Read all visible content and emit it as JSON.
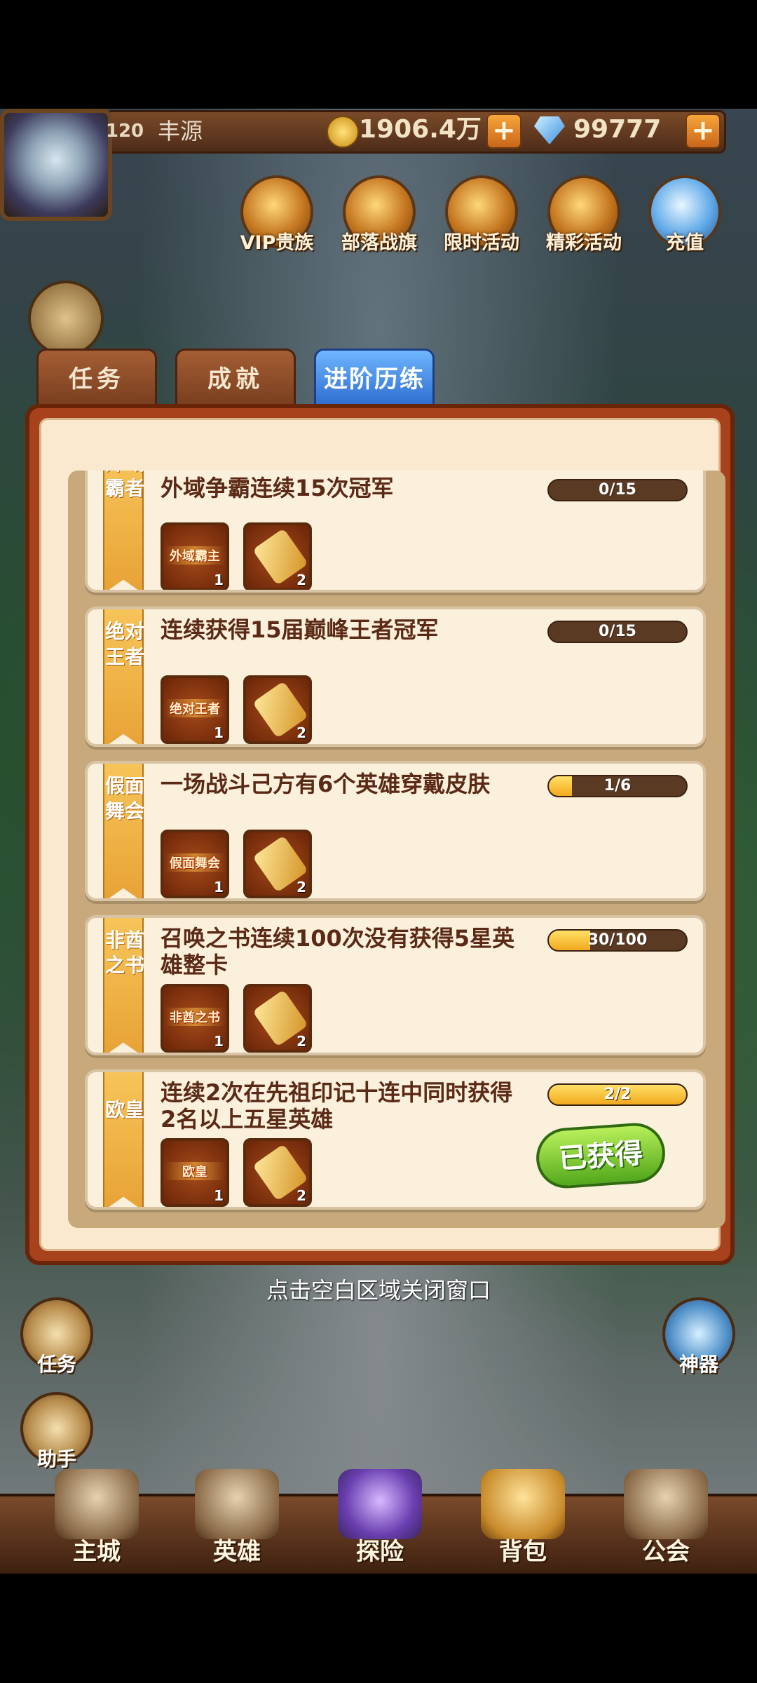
{
  "player": {
    "level": "120",
    "name": "丰源"
  },
  "currency": {
    "gold": "1906.4万",
    "gems": "99777",
    "plus": "+"
  },
  "top_icons": [
    {
      "label": "VIP贵族",
      "icon": "crown-icon"
    },
    {
      "label": "部落战旗",
      "icon": "war-flag-icon"
    },
    {
      "label": "限时活动",
      "icon": "compass-icon"
    },
    {
      "label": "精彩活动",
      "icon": "scroll-icon"
    },
    {
      "label": "充值",
      "icon": "diamond-icon"
    }
  ],
  "tabs": [
    {
      "label": "任务",
      "active": false
    },
    {
      "label": "成就",
      "active": false
    },
    {
      "label": "进阶历练",
      "active": true
    }
  ],
  "achievements": [
    {
      "ribbon": "外域霸者",
      "title": "外域争霸连续15次冠军",
      "progress": "0/15",
      "fraction": 0,
      "rewards": [
        {
          "label": "外域霸主",
          "count": "1"
        },
        {
          "label": "",
          "count": "2"
        }
      ],
      "obtained": ""
    },
    {
      "ribbon": "绝对王者",
      "title": "连续获得15届巅峰王者冠军",
      "progress": "0/15",
      "fraction": 0,
      "rewards": [
        {
          "label": "绝对王者",
          "count": "1"
        },
        {
          "label": "",
          "count": "2"
        }
      ],
      "obtained": ""
    },
    {
      "ribbon": "假面舞会",
      "title": "一场战斗己方有6个英雄穿戴皮肤",
      "progress": "1/6",
      "fraction": 0.167,
      "rewards": [
        {
          "label": "假面舞会",
          "count": "1"
        },
        {
          "label": "",
          "count": "2"
        }
      ],
      "obtained": ""
    },
    {
      "ribbon": "非酋之书",
      "title": "召唤之书连续100次没有获得5星英雄整卡",
      "progress": "30/100",
      "fraction": 0.3,
      "rewards": [
        {
          "label": "非酋之书",
          "count": "1"
        },
        {
          "label": "",
          "count": "2"
        }
      ],
      "obtained": ""
    },
    {
      "ribbon": "欧皇",
      "title": "连续2次在先祖印记十连中同时获得2名以上五星英雄",
      "progress": "2/2",
      "fraction": 1,
      "rewards": [
        {
          "label": "欧皇",
          "count": "1"
        },
        {
          "label": "",
          "count": "2"
        }
      ],
      "obtained": "已获得"
    }
  ],
  "close_hint": "点击空白区域关闭窗口",
  "side_buttons": {
    "left_top": "任务",
    "left_bottom": "助手",
    "right": "神器"
  },
  "bottom_nav": [
    {
      "label": "主城",
      "icon": "castle-icon"
    },
    {
      "label": "英雄",
      "icon": "hero-icon"
    },
    {
      "label": "探险",
      "icon": "portal-icon"
    },
    {
      "label": "背包",
      "icon": "backpack-icon"
    },
    {
      "label": "公会",
      "icon": "guild-icon"
    }
  ]
}
